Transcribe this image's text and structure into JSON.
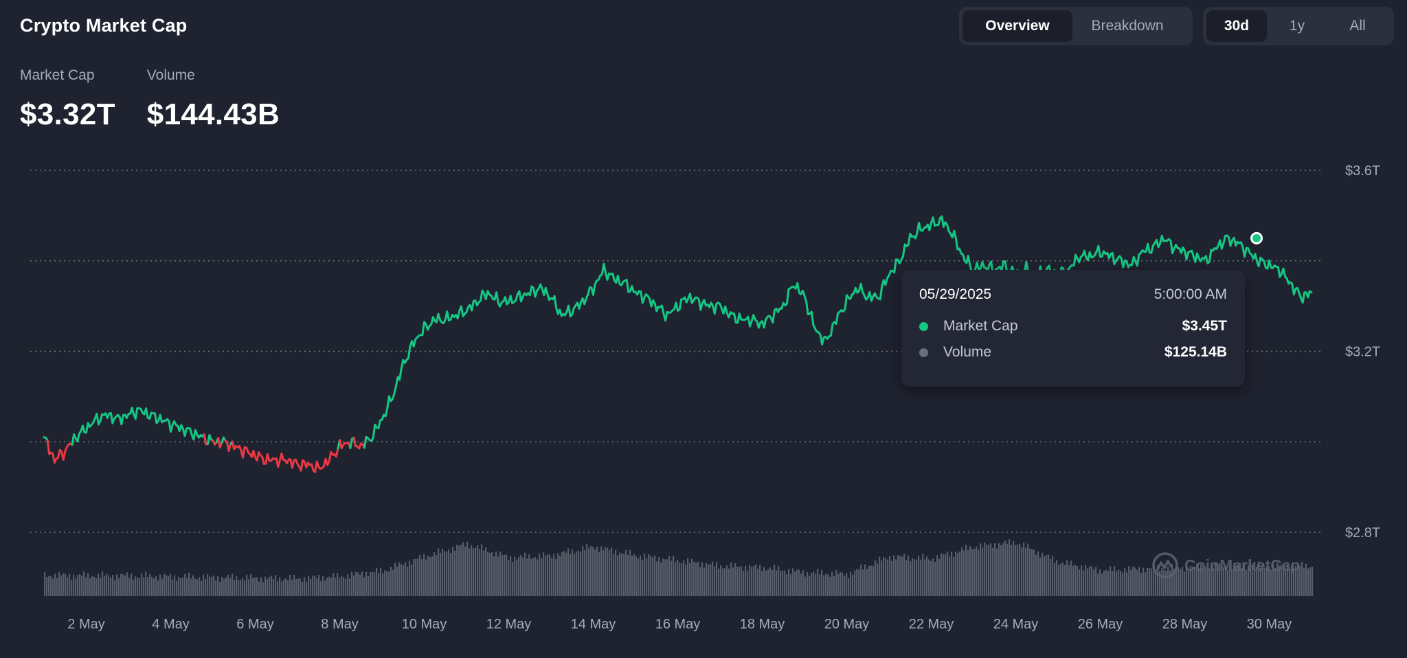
{
  "header": {
    "title": "Crypto Market Cap"
  },
  "stats": [
    {
      "label": "Market Cap",
      "value": "$3.32T"
    },
    {
      "label": "Volume",
      "value": "$144.43B"
    }
  ],
  "view_toggle": {
    "options": [
      "Overview",
      "Breakdown"
    ],
    "selected": "Overview"
  },
  "range_toggle": {
    "options": [
      "30d",
      "1y",
      "All"
    ],
    "selected": "30d"
  },
  "tooltip": {
    "date": "05/29/2025",
    "time": "5:00:00 AM",
    "rows": [
      {
        "label": "Market Cap",
        "value": "$3.45T",
        "color": "#16c784"
      },
      {
        "label": "Volume",
        "value": "$125.14B",
        "color": "#6b6f7b"
      }
    ]
  },
  "watermark": {
    "text": "CoinMarketCap"
  },
  "colors": {
    "up": "#16c784",
    "down": "#ea3943",
    "volume": "#5a5e6a",
    "background": "#1f2330"
  },
  "chart_data": {
    "type": "line",
    "x_range": [
      "1 May",
      "30 May"
    ],
    "x_ticks": [
      "2 May",
      "4 May",
      "6 May",
      "8 May",
      "10 May",
      "12 May",
      "14 May",
      "16 May",
      "18 May",
      "20 May",
      "22 May",
      "24 May",
      "26 May",
      "28 May",
      "30 May"
    ],
    "y_ticks": [
      "$3.6T",
      "$3.2T",
      "$2.8T"
    ],
    "ylim": [
      2.8,
      3.6
    ],
    "y_unit": "T USD",
    "grid": true,
    "baseline": 3.0,
    "series": [
      {
        "name": "Market Cap",
        "x_day": [
          0.0,
          0.25,
          0.5,
          0.75,
          1.0,
          1.25,
          1.5,
          1.75,
          2.0,
          2.25,
          2.5,
          2.75,
          3.0,
          3.25,
          3.5,
          3.75,
          4.0,
          4.25,
          4.5,
          4.75,
          5.0,
          5.25,
          5.5,
          5.75,
          6.0,
          6.25,
          6.5,
          6.75,
          7.0,
          7.25,
          7.5,
          7.75,
          8.0,
          8.25,
          8.5,
          8.75,
          9.0,
          9.25,
          9.5,
          9.75,
          10.0,
          10.25,
          10.5,
          10.75,
          11.0,
          11.25,
          11.5,
          11.75,
          12.0,
          12.25,
          12.5,
          12.75,
          13.0,
          13.25,
          13.5,
          13.75,
          14.0,
          14.25,
          14.5,
          14.75,
          15.0,
          15.25,
          15.5,
          15.75,
          16.0,
          16.25,
          16.5,
          16.75,
          17.0,
          17.25,
          17.5,
          17.75,
          18.0,
          18.25,
          18.5,
          18.75,
          19.0,
          19.25,
          19.5,
          19.75,
          20.0,
          20.25,
          20.5,
          20.75,
          21.0,
          21.25,
          21.5,
          21.75,
          22.0,
          22.25,
          22.5,
          22.75,
          23.0,
          23.25,
          23.5,
          23.75,
          24.0,
          24.25,
          24.5,
          24.75,
          25.0,
          25.25,
          25.5,
          25.75,
          26.0,
          26.25,
          26.5,
          26.75,
          27.0,
          27.25,
          27.5,
          27.75,
          28.0,
          28.25,
          28.5,
          28.75,
          29.0,
          29.25,
          29.5,
          29.75,
          30.0
        ],
        "values": [
          3.01,
          2.96,
          2.98,
          3.01,
          3.03,
          3.05,
          3.06,
          3.05,
          3.06,
          3.07,
          3.06,
          3.05,
          3.04,
          3.03,
          3.02,
          3.01,
          3.0,
          3.0,
          2.99,
          2.98,
          2.97,
          2.96,
          2.96,
          2.96,
          2.95,
          2.95,
          2.94,
          2.96,
          2.99,
          3.0,
          2.99,
          3.01,
          3.05,
          3.1,
          3.17,
          3.22,
          3.25,
          3.27,
          3.27,
          3.28,
          3.29,
          3.31,
          3.33,
          3.31,
          3.31,
          3.32,
          3.33,
          3.34,
          3.32,
          3.28,
          3.29,
          3.31,
          3.34,
          3.38,
          3.36,
          3.35,
          3.33,
          3.32,
          3.3,
          3.28,
          3.3,
          3.32,
          3.31,
          3.3,
          3.3,
          3.28,
          3.27,
          3.27,
          3.26,
          3.28,
          3.3,
          3.35,
          3.32,
          3.25,
          3.22,
          3.27,
          3.31,
          3.34,
          3.32,
          3.32,
          3.37,
          3.4,
          3.45,
          3.47,
          3.48,
          3.49,
          3.46,
          3.41,
          3.38,
          3.39,
          3.38,
          3.39,
          3.37,
          3.38,
          3.37,
          3.38,
          3.37,
          3.38,
          3.41,
          3.41,
          3.42,
          3.41,
          3.4,
          3.39,
          3.42,
          3.43,
          3.45,
          3.43,
          3.42,
          3.41,
          3.4,
          3.43,
          3.45,
          3.44,
          3.42,
          3.4,
          3.39,
          3.38,
          3.35,
          3.32,
          3.33
        ]
      },
      {
        "name": "Volume",
        "x_day": [
          0,
          2,
          4,
          6,
          7,
          8,
          9,
          10,
          11,
          12,
          13,
          14,
          15,
          16,
          17,
          18,
          19,
          20,
          21,
          22,
          23,
          24,
          25,
          26,
          27,
          28,
          29,
          30
        ],
        "values_relative": [
          0.38,
          0.37,
          0.34,
          0.32,
          0.36,
          0.46,
          0.72,
          0.95,
          0.7,
          0.74,
          0.9,
          0.74,
          0.65,
          0.55,
          0.52,
          0.43,
          0.4,
          0.72,
          0.68,
          0.9,
          0.98,
          0.62,
          0.47,
          0.5,
          0.52,
          0.55,
          0.55,
          0.55
        ]
      }
    ],
    "highlight": {
      "x_day": 28.7,
      "value": 3.45
    }
  }
}
